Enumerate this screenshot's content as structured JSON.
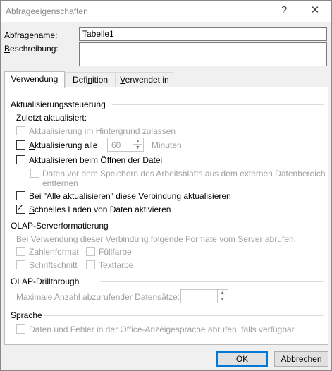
{
  "window": {
    "title": "Abfrageeigenschaften",
    "help_glyph": "?",
    "close_glyph": "✕"
  },
  "fields": {
    "name_label_pre": "Abfrage",
    "name_label_ul": "n",
    "name_label_post": "ame:",
    "name_value": "Tabelle1",
    "desc_label_ul": "B",
    "desc_label_post": "eschreibung:",
    "desc_value": ""
  },
  "tabs": [
    {
      "label_ul": "V",
      "label_post": "erwendung",
      "active": true
    },
    {
      "label_pre": "Defi",
      "label_ul": "n",
      "label_post": "ition",
      "active": false
    },
    {
      "label_ul": "V",
      "label_post": "erwendet in",
      "active": false
    }
  ],
  "refresh": {
    "group_title": "Aktualisierungssteuerung",
    "last_updated": "Zuletzt aktualisiert:",
    "background": "Aktualisierung im Hintergrund zulassen",
    "every_ul": "A",
    "every_post": "ktualisierung alle",
    "every_value": "60",
    "minutes": "Minuten",
    "on_open_pre": "A",
    "on_open_ul": "k",
    "on_open_post": "tualisieren beim Öffnen der Datei",
    "remove_line1": "Daten vor dem Speichern des Arbeitsblatts aus dem externen Datenbereich",
    "remove_line2": "entfernen",
    "all_ul": "B",
    "all_post": "ei \"Alle aktualisieren\" diese Verbindung aktualisieren",
    "fast_ul": "S",
    "fast_post": "chnelles Laden von Daten aktivieren"
  },
  "olap": {
    "group_title": "OLAP-Serverformatierung",
    "desc": "Bei Verwendung dieser Verbindung folgende Formate vom Server abrufen:",
    "number_format": "Zahlenformat",
    "fill_color": "Füllfarbe",
    "font_style": "Schriftschnitt",
    "text_color": "Textfarbe"
  },
  "drill": {
    "group_title": "OLAP-Drillthrough",
    "max_records": "Maximale Anzahl abzurufender Datensätze:",
    "max_value": ""
  },
  "language": {
    "group_title": "Sprache",
    "office_lang": "Daten und Fehler in der Office-Anzeigesprache abrufen, falls verfügbar"
  },
  "buttons": {
    "ok": "OK",
    "cancel": "Abbrechen"
  }
}
